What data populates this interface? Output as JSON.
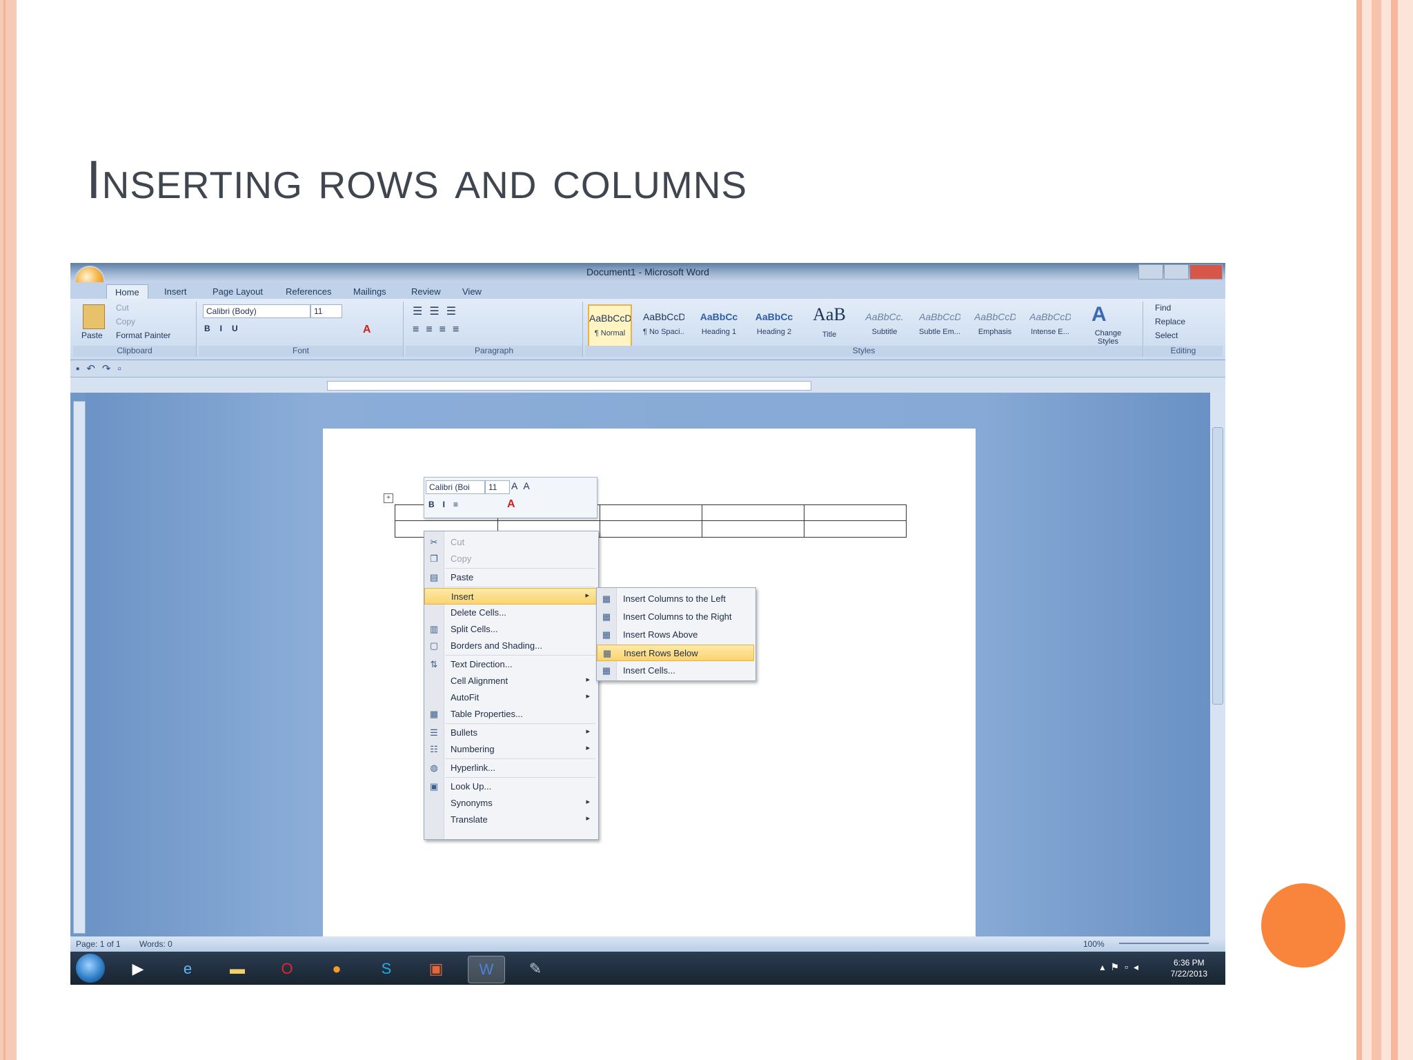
{
  "slide": {
    "title": "Inserting rows and columns"
  },
  "window": {
    "title": "Document1 - Microsoft Word"
  },
  "tabs": [
    "Home",
    "Insert",
    "Page Layout",
    "References",
    "Mailings",
    "Review",
    "View"
  ],
  "ribbon": {
    "clipboard": {
      "paste": "Paste",
      "cut": "Cut",
      "copy": "Copy",
      "format_painter": "Format Painter",
      "label": "Clipboard"
    },
    "font": {
      "name": "Calibri (Body)",
      "size": "11",
      "label": "Font"
    },
    "paragraph": {
      "label": "Paragraph"
    },
    "styles": {
      "label": "Styles",
      "items": [
        {
          "sample": "AaBbCcDc",
          "name": "¶ Normal"
        },
        {
          "sample": "AaBbCcDc",
          "name": "¶ No Spaci..."
        },
        {
          "sample": "AaBbCc",
          "name": "Heading 1"
        },
        {
          "sample": "AaBbCc",
          "name": "Heading 2"
        },
        {
          "sample": "AaB",
          "name": "Title"
        },
        {
          "sample": "AaBbCc.",
          "name": "Subtitle"
        },
        {
          "sample": "AaBbCcDc",
          "name": "Subtle Em..."
        },
        {
          "sample": "AaBbCcDc",
          "name": "Emphasis"
        },
        {
          "sample": "AaBbCcDc",
          "name": "Intense E..."
        }
      ],
      "change_styles": "Change Styles"
    },
    "editing": {
      "find": "Find",
      "replace": "Replace",
      "select": "Select",
      "label": "Editing"
    }
  },
  "mini_toolbar": {
    "font": "Calibri (Boi",
    "size": "11"
  },
  "context_menu": {
    "items": [
      {
        "label": "Cut",
        "icon": "scissors",
        "disabled": true
      },
      {
        "label": "Copy",
        "icon": "copy",
        "disabled": true
      },
      {
        "label": "Paste",
        "icon": "clipboard"
      },
      {
        "label": "Insert",
        "submenu": true,
        "highlighted": true
      },
      {
        "label": "Delete Cells..."
      },
      {
        "label": "Split Cells...",
        "icon": "split"
      },
      {
        "label": "Borders and Shading...",
        "icon": "border"
      },
      {
        "label": "Text Direction...",
        "icon": "text-direction"
      },
      {
        "label": "Cell Alignment",
        "submenu": true
      },
      {
        "label": "AutoFit",
        "submenu": true
      },
      {
        "label": "Table Properties...",
        "icon": "table"
      },
      {
        "label": "Bullets",
        "submenu": true,
        "icon": "bullets"
      },
      {
        "label": "Numbering",
        "submenu": true,
        "icon": "numbering"
      },
      {
        "label": "Hyperlink...",
        "icon": "globe"
      },
      {
        "label": "Look Up...",
        "icon": "book"
      },
      {
        "label": "Synonyms",
        "submenu": true
      },
      {
        "label": "Translate",
        "submenu": true
      }
    ]
  },
  "insert_submenu": {
    "items": [
      {
        "label": "Insert Columns to the Left"
      },
      {
        "label": "Insert Columns to the Right"
      },
      {
        "label": "Insert Rows Above"
      },
      {
        "label": "Insert Rows Below",
        "highlighted": true
      },
      {
        "label": "Insert Cells..."
      }
    ]
  },
  "status": {
    "page": "Page: 1 of 1",
    "words": "Words: 0",
    "zoom": "100%"
  },
  "taskbar": {
    "time": "6:36 PM",
    "date": "7/22/2013"
  },
  "colors": {
    "accent_dot": "#f8853b",
    "ribbon": "#c9daef",
    "highlight": "#fbd46f"
  }
}
